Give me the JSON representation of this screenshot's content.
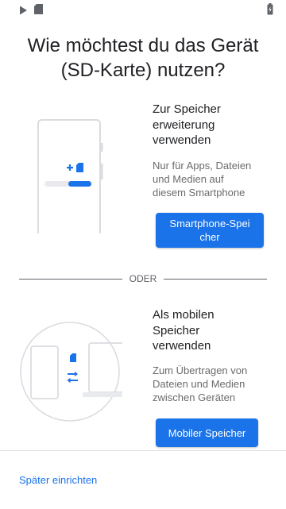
{
  "status_bar": {
    "play_icon": "play-store-icon",
    "sd_icon": "sd-card-icon",
    "battery_icon": "battery-icon"
  },
  "title": {
    "line1": "Wie möchtest du das Gerät",
    "line2": "(SD-Karte) nutzen?"
  },
  "option_phone": {
    "heading": [
      "Zur Speicher",
      "erweiterung",
      "verwenden"
    ],
    "description": [
      "Nur für Apps, Dateien",
      "und Medien auf",
      "diesem Smartphone"
    ],
    "button_label": [
      "Smartphone-Spei",
      "cher"
    ]
  },
  "divider": {
    "label": "ODER"
  },
  "option_portable": {
    "heading": [
      "Als mobilen",
      "Speicher",
      "verwenden"
    ],
    "description": [
      "Zum Übertragen von",
      "Dateien und Medien",
      "zwischen Geräten"
    ],
    "button_label": "Mobiler Speicher"
  },
  "footer": {
    "setup_later": "Später einrichten"
  },
  "colors": {
    "accent": "#1a73e8",
    "text_primary": "#202124",
    "text_secondary": "#6b6b6b",
    "illustration_stroke": "#dadce0"
  }
}
